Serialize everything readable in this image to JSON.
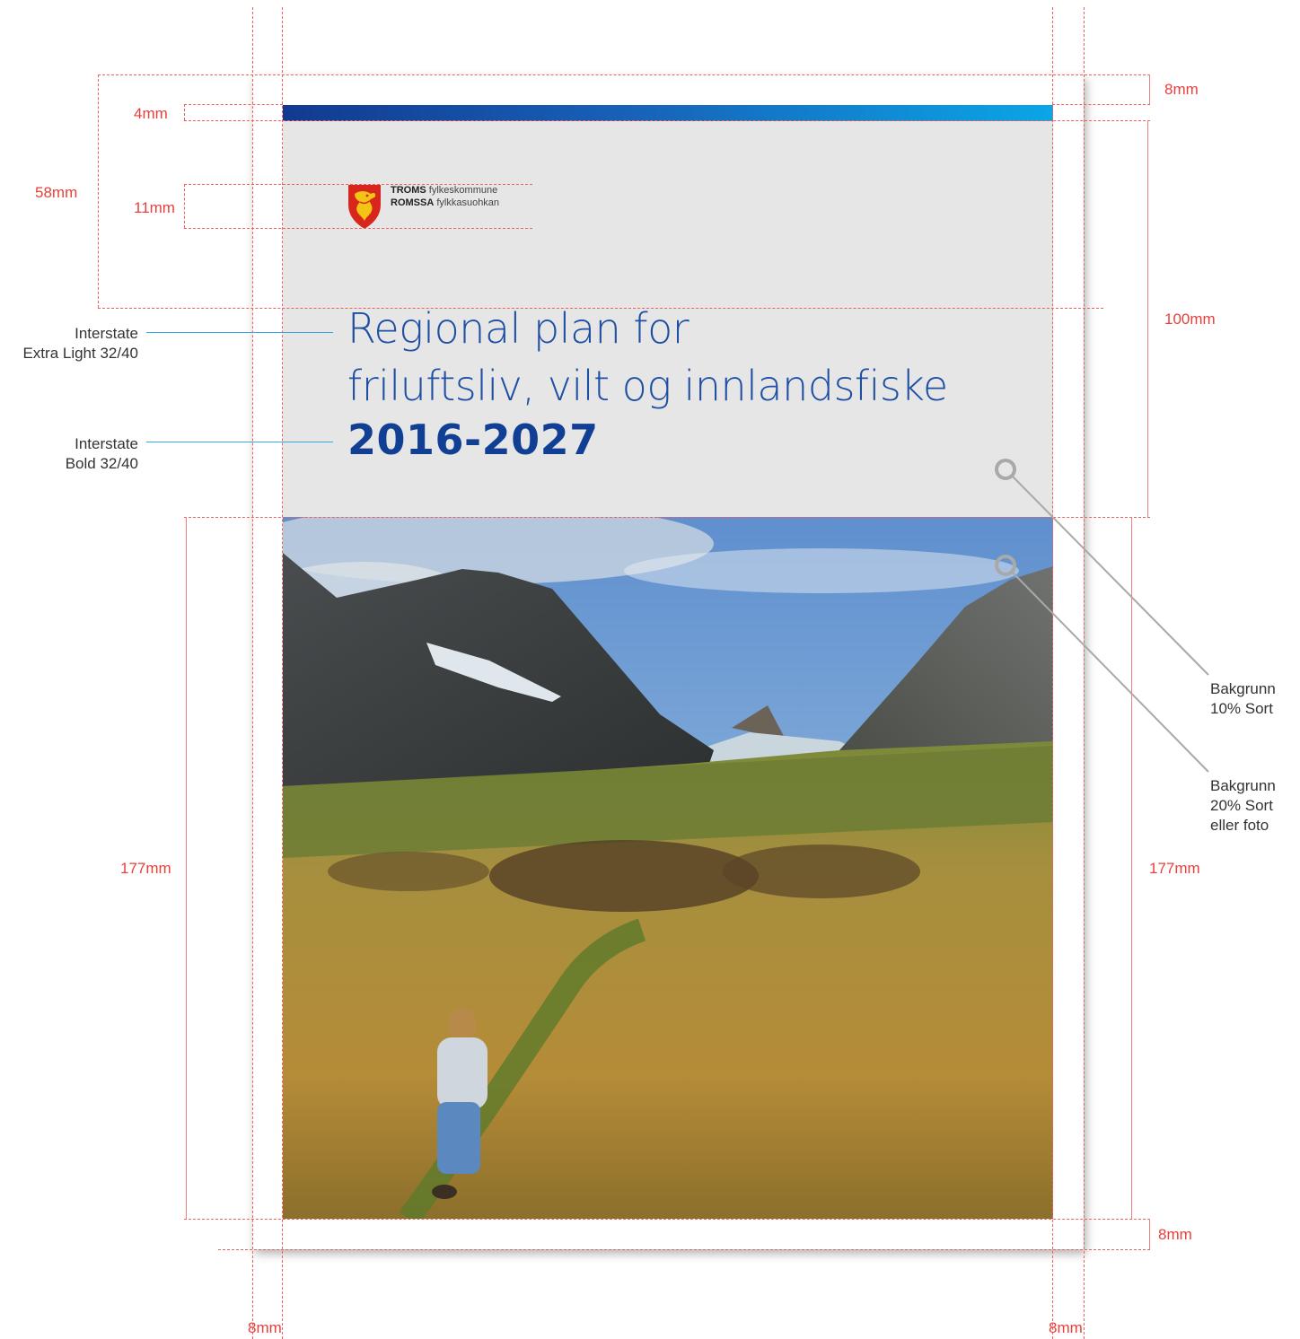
{
  "cover": {
    "logo_line1_bold": "TROMS",
    "logo_line1_rest": " fylkeskommune",
    "logo_line2_bold": "ROMSSA",
    "logo_line2_rest": " fylkkasuohkan",
    "title_line1": "Regional plan for",
    "title_line2": "friluftsliv, vilt og innlandsfiske",
    "title_year": "2016-2027"
  },
  "dimensions": {
    "top_margin": "8mm",
    "bar_height": "4mm",
    "header_height": "58mm",
    "logo_height": "11mm",
    "grey_area_height": "100mm",
    "photo_height_left": "177mm",
    "photo_height_right": "177mm",
    "bottom_margin": "8mm",
    "left_margin": "8mm",
    "right_margin": "8mm"
  },
  "annotations": {
    "title_font_1": "Interstate",
    "title_font_2": "Extra Light 32/40",
    "year_font_1": "Interstate",
    "year_font_2": "Bold 32/40",
    "bg1_line1": "Bakgrunn",
    "bg1_line2": "10% Sort",
    "bg2_line1": "Bakgrunn",
    "bg2_line2": "20% Sort",
    "bg2_line3": "eller foto"
  },
  "colors": {
    "brand_blue": "#1e4fa3",
    "brand_blue_dark": "#113f94",
    "grey_background": "#e6e6e7",
    "guide_red": "#e8403a",
    "leader_cyan": "#35a8df"
  },
  "icons": {
    "crest": "troms-crest-icon"
  }
}
